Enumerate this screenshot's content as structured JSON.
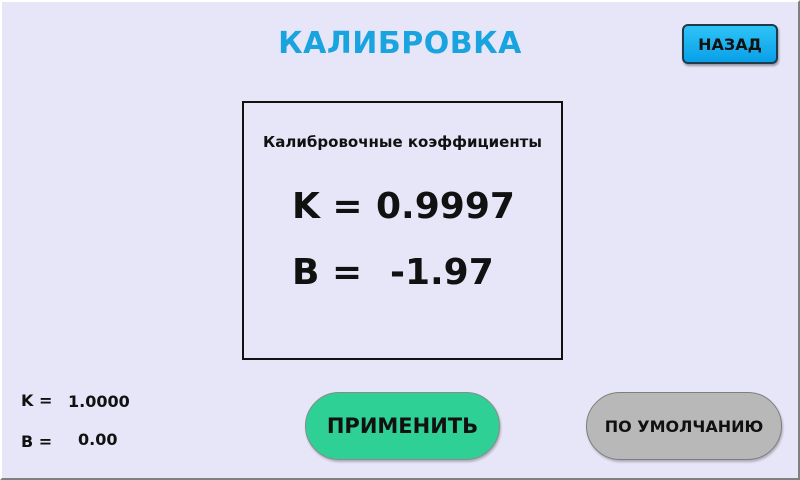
{
  "header": {
    "title": "КАЛИБРОВКА",
    "back_label": "НАЗАД"
  },
  "calibration": {
    "heading": "Калибровочные коэффициенты",
    "k_label": "K =",
    "k_value": "0.9997",
    "b_label": "B =",
    "b_value": "-1.97"
  },
  "current": {
    "k_label": "K =",
    "k_value": "1.0000",
    "b_label": "B =",
    "b_value": "0.00"
  },
  "actions": {
    "apply_label": "ПРИМЕНИТЬ",
    "default_label": "ПО УМОЛЧАНИЮ"
  },
  "colors": {
    "background": "#e6e6f8",
    "title": "#1aa4df",
    "back_button": "#0aa0e8",
    "apply_button": "#2ed095",
    "default_button": "#b8b8b8"
  }
}
